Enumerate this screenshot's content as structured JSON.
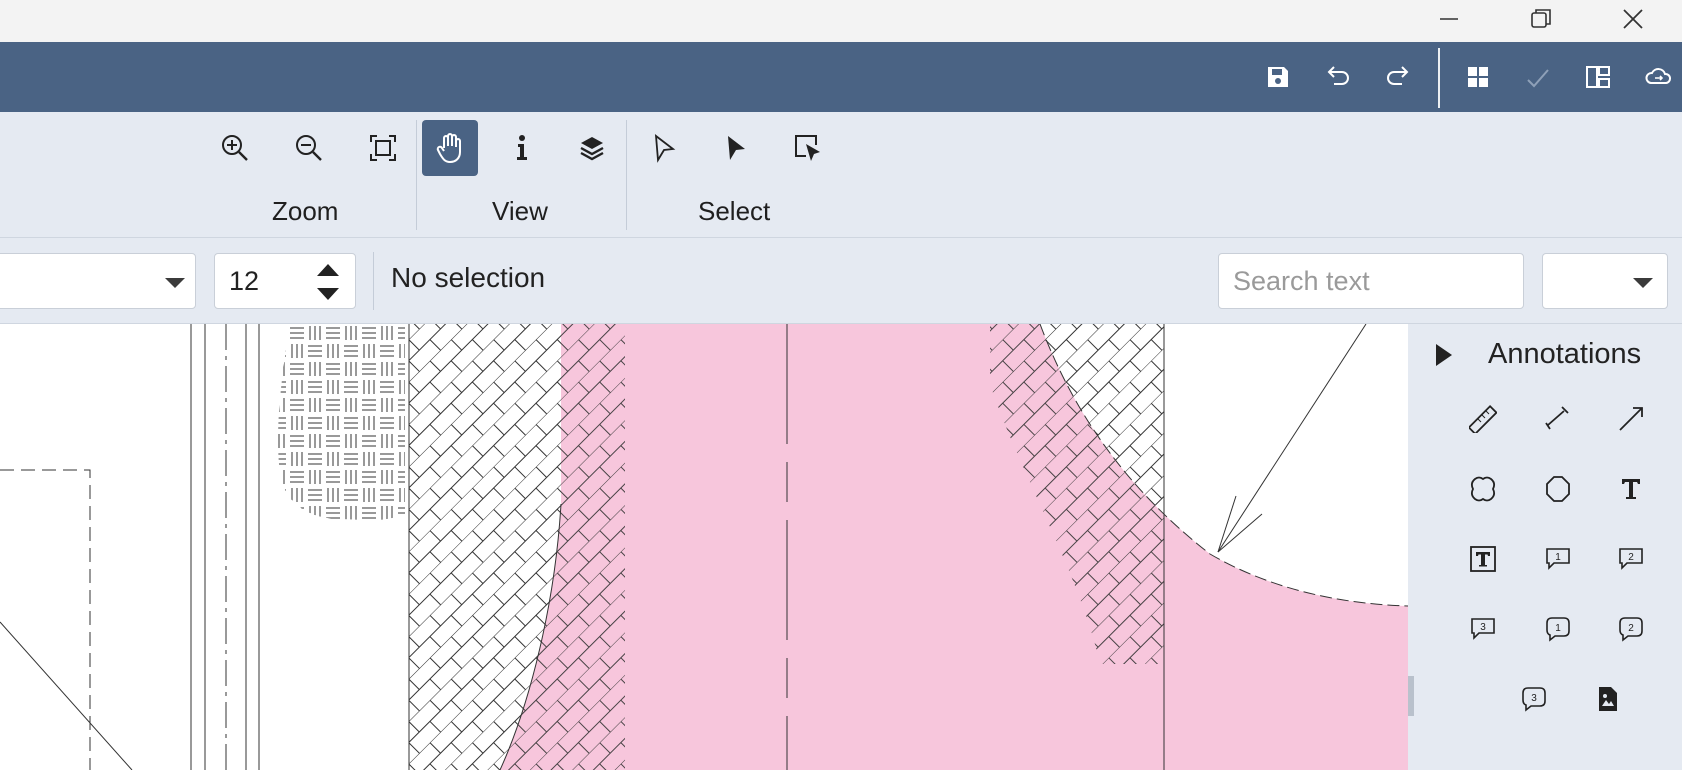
{
  "ribbon": {
    "groups": {
      "zoom": "Zoom",
      "view": "View",
      "select": "Select"
    },
    "colors": {
      "accent": "#4a6384",
      "ribbon_bg": "#e5eaf2"
    }
  },
  "toolbar": {
    "font_size": "12",
    "selection_status": "No selection",
    "search_placeholder": "Search text"
  },
  "annotations": {
    "title": "Annotations",
    "tools": [
      "ruler-icon",
      "angle-measure-icon",
      "arrow-line-icon",
      "cloud-icon",
      "polygon-icon",
      "text-icon",
      "textbox-icon",
      "callout-1-icon",
      "callout-2-icon",
      "callout-3-icon",
      "bubble-1-icon",
      "bubble-2-icon",
      "bubble-3-icon",
      "image-stamp-icon"
    ]
  },
  "drawing": {
    "fill_color": "#f7c6dc",
    "line_color": "#333333"
  }
}
